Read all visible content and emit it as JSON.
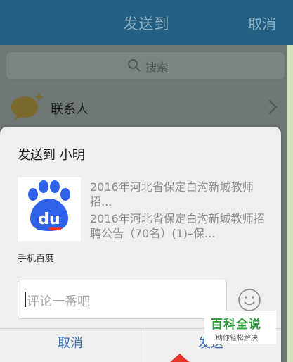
{
  "top_bar": {
    "title": "发送到",
    "cancel_label": "取消"
  },
  "search": {
    "placeholder": "搜索"
  },
  "contacts": {
    "label": "联系人"
  },
  "dialog": {
    "title": "发送到 小明",
    "article_title": "2016年河北省保定白沟新城教师招...",
    "article_desc": "2016年河北省保定白沟新城教师招聘公告（70名）(1)–保...",
    "source": "手机百度",
    "comment_placeholder": "评论一番吧",
    "cancel_label": "取消",
    "send_label": "发送"
  },
  "watermark": {
    "title": "百科全说",
    "subtitle": "助你轻松解决"
  },
  "colors": {
    "top_bar": "#235f82",
    "dialog_button": "#3b73b8",
    "baidu_blue": "#2f62e8",
    "baidu_red": "#e8352c",
    "watermark_green": "#2a9b3a"
  },
  "icons": {
    "search": "search-icon",
    "contacts": "chat-bubble-plus-icon",
    "chevron": "chevron-right-icon",
    "logo": "baidu-paw-logo",
    "emoji": "smiley-icon",
    "arrow": "red-arrow-icon"
  }
}
